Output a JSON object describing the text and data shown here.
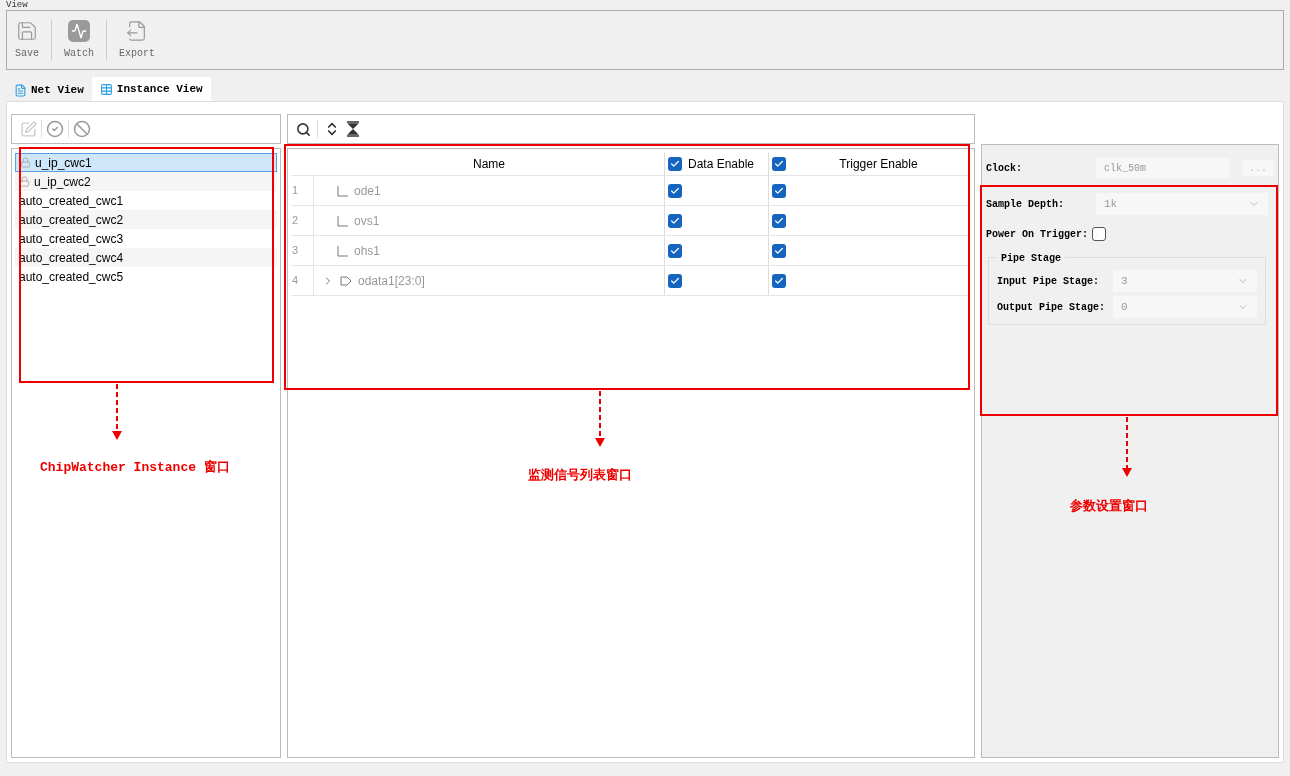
{
  "menu": [
    {
      "label": "View"
    }
  ],
  "toolbar": [
    {
      "kind": "save",
      "label": "Save"
    },
    {
      "kind": "watch",
      "label": "Watch"
    },
    {
      "kind": "export",
      "label": "Export"
    }
  ],
  "tabs": [
    {
      "label": "Net View",
      "selected": false
    },
    {
      "label": "Instance View",
      "selected": true
    }
  ],
  "instances": [
    {
      "name": "u_ip_cwc1",
      "locked": true,
      "selected": true
    },
    {
      "name": "u_ip_cwc2",
      "locked": true,
      "selected": false
    },
    {
      "name": "auto_created_cwc1",
      "locked": false,
      "selected": false
    },
    {
      "name": "auto_created_cwc2",
      "locked": false,
      "selected": false
    },
    {
      "name": "auto_created_cwc3",
      "locked": false,
      "selected": false
    },
    {
      "name": "auto_created_cwc4",
      "locked": false,
      "selected": false
    },
    {
      "name": "auto_created_cwc5",
      "locked": false,
      "selected": false
    }
  ],
  "signals": {
    "columns": {
      "name": "Name",
      "data_enable": {
        "label": "Data Enable",
        "checked": true
      },
      "trigger_enable": {
        "label": "Trigger Enable",
        "checked": true
      }
    },
    "rows": [
      {
        "index": "1",
        "name": "ode1",
        "kind": "bit",
        "data_enable": true,
        "trigger_enable": true
      },
      {
        "index": "2",
        "name": "ovs1",
        "kind": "bit",
        "data_enable": true,
        "trigger_enable": true
      },
      {
        "index": "3",
        "name": "ohs1",
        "kind": "bit",
        "data_enable": true,
        "trigger_enable": true
      },
      {
        "index": "4",
        "name": "odata1[23:0]",
        "kind": "bus",
        "data_enable": true,
        "trigger_enable": true
      }
    ]
  },
  "params": {
    "clock": {
      "label": "Clock:",
      "value": "clk_50m",
      "button": "..."
    },
    "sample_depth": {
      "label": "Sample Depth:",
      "value": "1k"
    },
    "power_on_trigger": {
      "label": "Power On Trigger:",
      "checked": false
    },
    "pipe_stage": {
      "title": "Pipe Stage",
      "input": {
        "label": "Input Pipe Stage:",
        "value": "3"
      },
      "output": {
        "label": "Output Pipe Stage:",
        "value": "0"
      }
    }
  },
  "annotations": [
    {
      "label": "ChipWatcher Instance 窗口"
    },
    {
      "label": "监测信号列表窗口"
    },
    {
      "label": "参数设置窗口"
    }
  ]
}
